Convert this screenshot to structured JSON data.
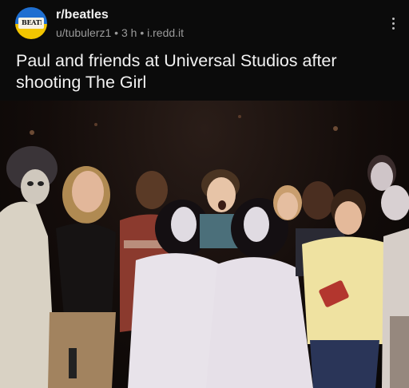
{
  "post": {
    "subreddit": "r/beatles",
    "author": "u/tubulerz1",
    "age": "3 h",
    "domain": "i.redd.it",
    "separator": " • ",
    "title": "Paul and friends at Universal Studios after shooting The Girl"
  },
  "avatar": {
    "text": "BEATLES",
    "top_color": "#1f6fd1",
    "bottom_color": "#f2c500"
  },
  "icons": {
    "more": "vertical-ellipsis-icon"
  },
  "colors": {
    "background": "#0b0b0b",
    "meta_text": "#9a9a9a",
    "title_text": "#f2f2f2"
  }
}
